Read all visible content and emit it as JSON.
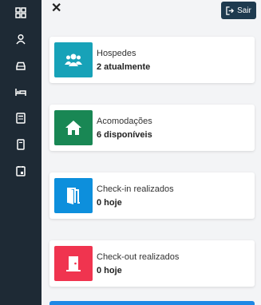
{
  "topbar": {
    "close_glyph": "✕",
    "logout_label": "Sair",
    "logout_icon": "sign-out-icon"
  },
  "sidebar": {
    "items": [
      {
        "icon": "dashboard-icon"
      },
      {
        "icon": "user-icon"
      },
      {
        "icon": "car-icon"
      },
      {
        "icon": "bed-icon"
      },
      {
        "icon": "calculator-icon"
      },
      {
        "icon": "document-icon"
      },
      {
        "icon": "calendar-icon"
      }
    ]
  },
  "cards": [
    {
      "title": "Hospedes",
      "value": "2 atualmente",
      "color": "#17a2b8",
      "icon": "users-icon"
    },
    {
      "title": "Acomodações",
      "value": "6 disponíveis",
      "color": "#198754",
      "icon": "house-icon"
    },
    {
      "title": "Check-in realizados",
      "value": "0 hoje",
      "color": "#0d8fdc",
      "icon": "door-open-icon"
    },
    {
      "title": "Check-out realizados",
      "value": "0 hoje",
      "color": "#f0344f",
      "icon": "door-closed-icon"
    }
  ]
}
